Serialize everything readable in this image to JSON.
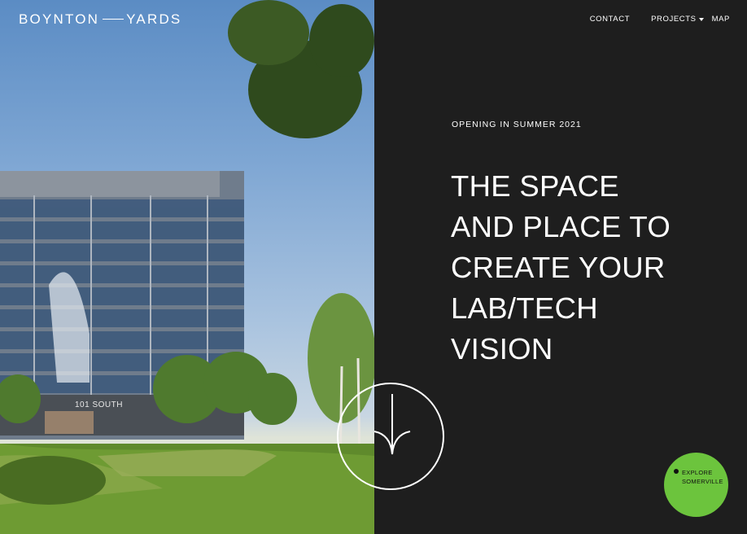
{
  "brand": {
    "part1": "BOYNTON",
    "part2": "YARDS"
  },
  "nav": {
    "contact": "CONTACT",
    "projects": "PROJECTS",
    "map": "MAP"
  },
  "hero": {
    "eyebrow": "OPENING IN SUMMER 2021",
    "headline_lines": [
      "THE SPACE",
      "AND PLACE TO",
      "CREATE YOUR",
      "LAB/TECH",
      "VISION"
    ],
    "building_sign": "101 SOUTH"
  },
  "explore": {
    "line1": "EXPLORE",
    "line2": "SOMERVILLE"
  },
  "icons": {
    "scroll": "arrow-down-icon",
    "caret": "caret-down-icon"
  },
  "colors": {
    "dark_panel": "#1e1e1e",
    "accent_green": "#6cc43d",
    "text": "#ffffff"
  }
}
